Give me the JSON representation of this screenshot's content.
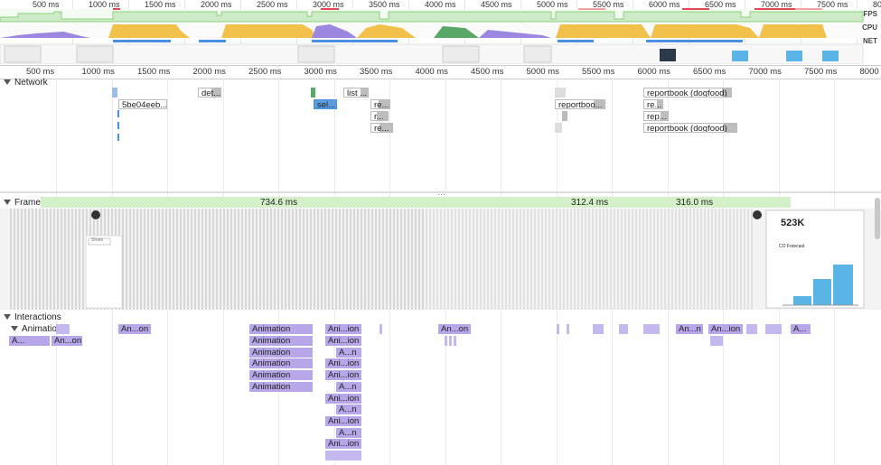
{
  "overview": {
    "ticks": [
      "500 ms",
      "1000 ms",
      "1500 ms",
      "2000 ms",
      "2500 ms",
      "3000 ms",
      "3500 ms",
      "4000 ms",
      "4500 ms",
      "5000 ms",
      "5500 ms",
      "6000 ms",
      "6500 ms",
      "7000 ms",
      "7500 ms",
      "80"
    ],
    "labels": {
      "fps": "FPS",
      "cpu": "CPU",
      "net": "NET"
    }
  },
  "ruler": {
    "ticks": [
      "500 ms",
      "1000 ms",
      "1500 ms",
      "2000 ms",
      "2500 ms",
      "3000 ms",
      "3500 ms",
      "4000 ms",
      "4500 ms",
      "5000 ms",
      "5500 ms",
      "6000 ms",
      "6500 ms",
      "7000 ms",
      "7500 ms",
      "8000"
    ]
  },
  "network": {
    "title": "Network",
    "requests": [
      {
        "label": "det..."
      },
      {
        "label": "5be04eeb..."
      },
      {
        "label": "list ..."
      },
      {
        "label": "sel..."
      },
      {
        "label": "re..."
      },
      {
        "label": "r..."
      },
      {
        "label": "re..."
      },
      {
        "label": "reportboo..."
      },
      {
        "label": "reportbook (dogfood)"
      },
      {
        "label": "re..."
      },
      {
        "label": "rep..."
      },
      {
        "label": "reportbook (dogfood)"
      }
    ]
  },
  "frames": {
    "title": "Frames",
    "durations": [
      "734.6 ms",
      "312.4 ms",
      "316.0 ms"
    ],
    "screenshot": {
      "value": "523K",
      "chart_title": "CO Forecast",
      "share": "Share"
    }
  },
  "interactions": {
    "title": "Interactions",
    "group": "Animation",
    "row0": [
      "An...on",
      "Animation",
      "Ani...ion",
      "An...on",
      "An...n",
      "An...ion",
      "A..."
    ],
    "row1": [
      "A...",
      "An...on",
      "Animation",
      "A...n"
    ],
    "col_animation": [
      "Animation",
      "Animation",
      "Animation",
      "Animation",
      "Animation"
    ],
    "col_ani": [
      "Ani...ion",
      "A...n",
      "Ani...ion",
      "Ani...ion",
      "A...n",
      "Ani...ion",
      "A...n",
      "Ani...ion",
      "A...n",
      "Ani...ion"
    ]
  },
  "colors": {
    "fps": "#8bd17c",
    "cpu_script": "#f2c14b",
    "cpu_render": "#9b86e0",
    "net_bar": "#4a90e2",
    "anim": "#b7a6e8"
  }
}
